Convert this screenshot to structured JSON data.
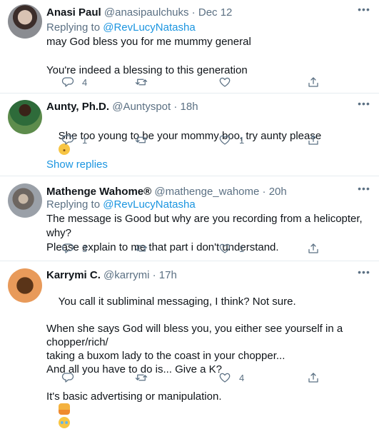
{
  "tweets": [
    {
      "name": "Anasi Paul",
      "handle": "@anasipaulchuks",
      "time": "Dec 12",
      "reply_prefix": "Replying to ",
      "reply_to": "@RevLucyNatasha",
      "body": "may God bless you for me mummy general\n\nYou're indeed a blessing to this generation",
      "replies": "4",
      "retweets": "",
      "likes": ""
    },
    {
      "name": "Aunty, Ph.D.",
      "handle": "@Auntyspot",
      "time": "18h",
      "body": "She too young to be your mommy boo, try aunty please",
      "replies": "1",
      "retweets": "",
      "likes": "1"
    },
    {
      "name": "Mathenge Wahome®",
      "handle": "@mathenge_wahome",
      "time": "20h",
      "reply_prefix": "Replying to ",
      "reply_to": "@RevLucyNatasha",
      "body": "The message is Good but why are you recording from a helicopter, why?\nPlease explain to me that part i don't understand.",
      "replies": "3",
      "retweets": "",
      "likes": "1"
    },
    {
      "name": "Karrymi C.",
      "handle": "@karrymi",
      "time": "17h",
      "body": "You call it subliminal messaging, I think? Not sure.\n\nWhen she says God will bless you, you either see yourself in a chopper/rich/\ntaking a buxom lady to the coast in your chopper...\nAnd all you have to do is... Give a K?\n\nIt's basic advertising or manipulation.",
      "replies": "",
      "retweets": "",
      "likes": "4"
    }
  ],
  "show_replies": "Show replies",
  "separator": " · ",
  "colors": {
    "link": "#1b95e0",
    "muted": "#5b7083",
    "text": "#0f1419",
    "border": "#e6ecf0"
  },
  "icons": [
    "reply-icon",
    "retweet-icon",
    "like-icon",
    "share-icon",
    "more-icon"
  ]
}
